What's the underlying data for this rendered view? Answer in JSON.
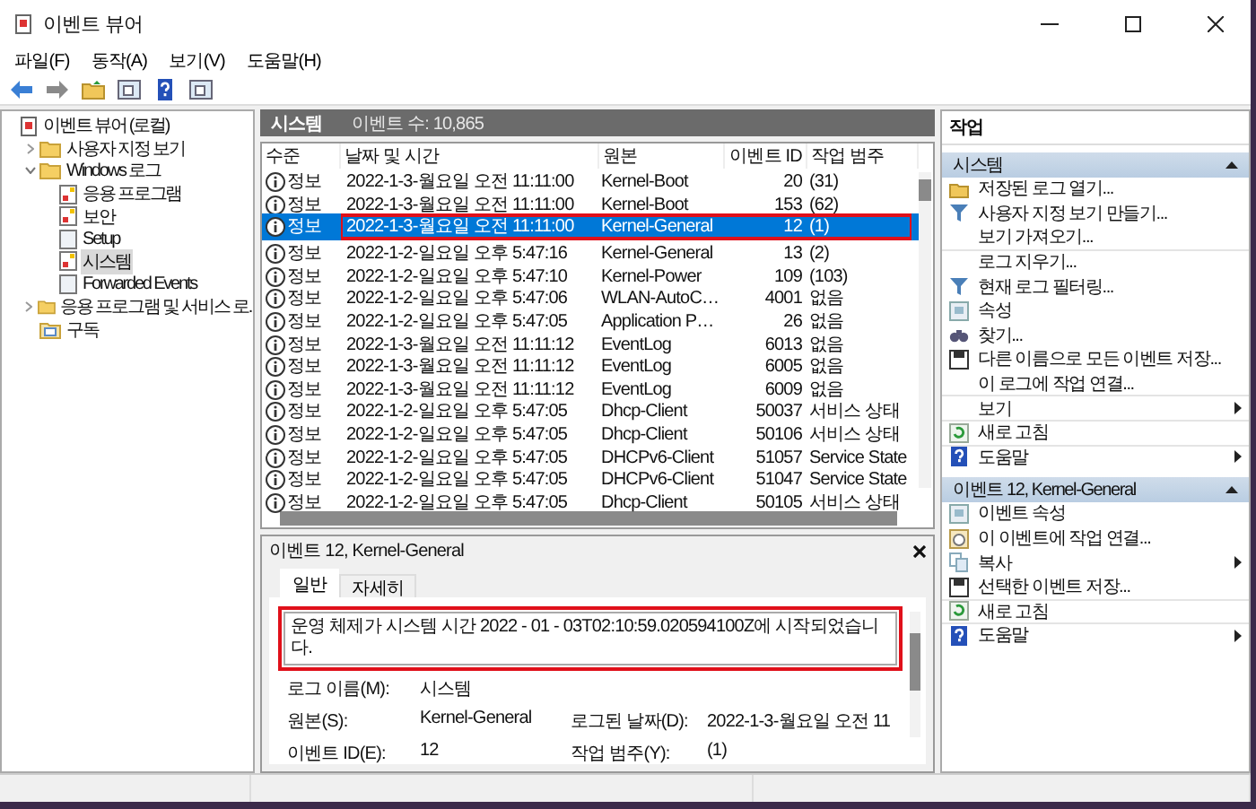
{
  "window": {
    "title": "이벤트 뷰어"
  },
  "menu": [
    "파일(F)",
    "동작(A)",
    "보기(V)",
    "도움말(H)"
  ],
  "toolbar": [
    {
      "kind": "back"
    },
    {
      "kind": "forward"
    },
    {
      "kind": "folder-up"
    },
    {
      "kind": "panel"
    },
    {
      "kind": "help"
    },
    {
      "kind": "panel"
    }
  ],
  "tree": [
    {
      "label": "이벤트 뷰어 (로컬)",
      "kind": "root",
      "selected": false,
      "children": [
        {
          "label": "사용자 지정 보기",
          "kind": "folder",
          "expanded": false,
          "selected": false
        },
        {
          "label": "Windows 로그",
          "kind": "folder",
          "expanded": true,
          "selected": false,
          "children": [
            {
              "label": "응용 프로그램",
              "kind": "log",
              "selected": false
            },
            {
              "label": "보안",
              "kind": "log",
              "selected": false
            },
            {
              "label": "Setup",
              "kind": "plain-log",
              "selected": false
            },
            {
              "label": "시스템",
              "kind": "log",
              "selected": true
            },
            {
              "label": "Forwarded Events",
              "kind": "plain-log",
              "selected": false
            }
          ]
        },
        {
          "label": "응용 프로그램 및 서비스 로.",
          "kind": "folder",
          "expanded": false,
          "selected": false
        },
        {
          "label": "구독",
          "kind": "subscription",
          "selected": false
        }
      ]
    }
  ],
  "log_header": {
    "title": "시스템",
    "count": "이벤트 수: 10,865"
  },
  "table": {
    "columns": [
      "수준",
      "날짜 및 시간",
      "원본",
      "이벤트 ID",
      "작업 범주"
    ],
    "rows": [
      {
        "level": "정보",
        "date": "2022-1-3-월요일 오전 11:11:00",
        "source": "Kernel-Boot",
        "id": "20",
        "category": "(31)",
        "selected": false,
        "highlighted": false
      },
      {
        "level": "정보",
        "date": "2022-1-3-월요일 오전 11:11:00",
        "source": "Kernel-Boot",
        "id": "153",
        "category": "(62)",
        "selected": false,
        "highlighted": false
      },
      {
        "level": "정보",
        "date": "2022-1-3-월요일 오전 11:11:00",
        "source": "Kernel-General",
        "id": "12",
        "category": "(1)",
        "selected": true,
        "highlighted": true
      },
      {
        "level": "정보",
        "date": "2022-1-2-일요일 오후 5:47:16",
        "source": "Kernel-General",
        "id": "13",
        "category": "(2)",
        "selected": false,
        "highlighted": false
      },
      {
        "level": "정보",
        "date": "2022-1-2-일요일 오후 5:47:10",
        "source": "Kernel-Power",
        "id": "109",
        "category": "(103)",
        "selected": false,
        "highlighted": false
      },
      {
        "level": "정보",
        "date": "2022-1-2-일요일 오후 5:47:06",
        "source": "WLAN-AutoC…",
        "id": "4001",
        "category": "없음",
        "selected": false,
        "highlighted": false
      },
      {
        "level": "정보",
        "date": "2022-1-2-일요일 오후 5:47:05",
        "source": "Application P…",
        "id": "26",
        "category": "없음",
        "selected": false,
        "highlighted": false
      },
      {
        "level": "정보",
        "date": "2022-1-3-월요일 오전 11:11:12",
        "source": "EventLog",
        "id": "6013",
        "category": "없음",
        "selected": false,
        "highlighted": false
      },
      {
        "level": "정보",
        "date": "2022-1-3-월요일 오전 11:11:12",
        "source": "EventLog",
        "id": "6005",
        "category": "없음",
        "selected": false,
        "highlighted": false
      },
      {
        "level": "정보",
        "date": "2022-1-3-월요일 오전 11:11:12",
        "source": "EventLog",
        "id": "6009",
        "category": "없음",
        "selected": false,
        "highlighted": false
      },
      {
        "level": "정보",
        "date": "2022-1-2-일요일 오후 5:47:05",
        "source": "Dhcp-Client",
        "id": "50037",
        "category": "서비스 상태",
        "selected": false,
        "highlighted": false
      },
      {
        "level": "정보",
        "date": "2022-1-2-일요일 오후 5:47:05",
        "source": "Dhcp-Client",
        "id": "50106",
        "category": "서비스 상태",
        "selected": false,
        "highlighted": false
      },
      {
        "level": "정보",
        "date": "2022-1-2-일요일 오후 5:47:05",
        "source": "DHCPv6-Client",
        "id": "51057",
        "category": "Service State",
        "selected": false,
        "highlighted": false
      },
      {
        "level": "정보",
        "date": "2022-1-2-일요일 오후 5:47:05",
        "source": "DHCPv6-Client",
        "id": "51047",
        "category": "Service State",
        "selected": false,
        "highlighted": false
      },
      {
        "level": "정보",
        "date": "2022-1-2-일요일 오후 5:47:05",
        "source": "Dhcp-Client",
        "id": "50105",
        "category": "서비스 상태",
        "selected": false,
        "highlighted": false
      }
    ]
  },
  "detail": {
    "title": "이벤트 12, Kernel-General",
    "tabs": [
      {
        "label": "일반",
        "selected": true
      },
      {
        "label": "자세히",
        "selected": false
      }
    ],
    "message": "운영 체제가 시스템 시간 2022 - 01 - 03T02:10:59.020594100Z에 시작되었습니다.",
    "message_highlighted": true,
    "fields": [
      {
        "label": "로그 이름(M):",
        "value": "시스템"
      },
      {
        "label": "원본(S):",
        "value": "Kernel-General"
      },
      {
        "label": "로그된 날짜(D):",
        "value": "2022-1-3-월요일 오전 11"
      },
      {
        "label": "이벤트 ID(E):",
        "value": "12"
      },
      {
        "label": "작업 범주(Y):",
        "value": "(1)"
      }
    ]
  },
  "actions": {
    "title": "작업",
    "groups": [
      {
        "title": "시스템",
        "items": [
          {
            "label": "저장된 로그 열기...",
            "kind": "folder"
          },
          {
            "label": "사용자 지정 보기 만들기...",
            "kind": "filter"
          },
          {
            "label": "보기 가져오기...",
            "kind": "plain",
            "separator_after": true
          },
          {
            "label": "로그 지우기...",
            "kind": "plain"
          },
          {
            "label": "현재 로그 필터링...",
            "kind": "filter"
          },
          {
            "label": "속성",
            "kind": "properties"
          },
          {
            "label": "찾기...",
            "kind": "binoculars"
          },
          {
            "label": "다른 이름으로 모든 이벤트 저장...",
            "kind": "save"
          },
          {
            "label": "이 로그에 작업 연결...",
            "kind": "plain",
            "separator_after": true
          },
          {
            "label": "보기",
            "kind": "plain",
            "submenu": true,
            "separator_after": true
          },
          {
            "label": "새로 고침",
            "kind": "refresh",
            "separator_after": true
          },
          {
            "label": "도움말",
            "kind": "help",
            "submenu": true
          }
        ]
      },
      {
        "title": "이벤트 12, Kernel-General",
        "items": [
          {
            "label": "이벤트 속성",
            "kind": "properties"
          },
          {
            "label": "이 이벤트에 작업 연결...",
            "kind": "task"
          },
          {
            "label": "복사",
            "kind": "copy",
            "submenu": true
          },
          {
            "label": "선택한 이벤트 저장...",
            "kind": "save",
            "separator_after": true
          },
          {
            "label": "새로 고침",
            "kind": "refresh",
            "separator_after": true
          },
          {
            "label": "도움말",
            "kind": "help",
            "submenu": true
          }
        ]
      }
    ]
  }
}
